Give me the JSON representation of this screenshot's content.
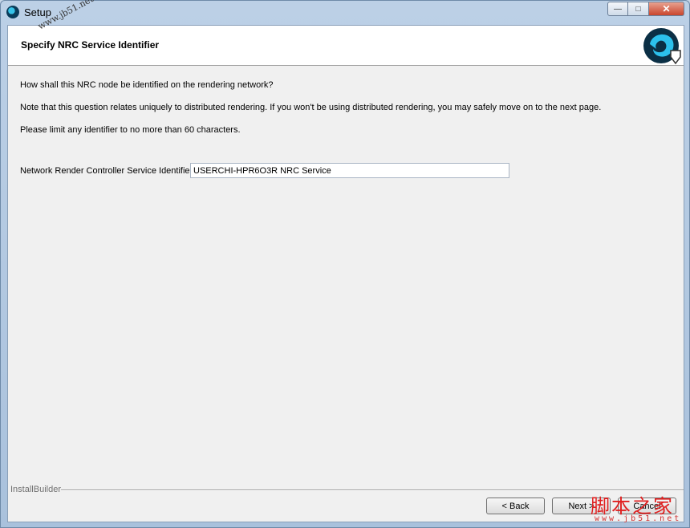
{
  "window": {
    "title": "Setup",
    "icon": "setup-app-icon"
  },
  "window_controls": {
    "minimize": "—",
    "maximize": "□",
    "close": "✕"
  },
  "header": {
    "title": "Specify NRC Service Identifier",
    "logo": "installbuilder-logo-icon"
  },
  "content": {
    "question": "How shall this NRC node be identified on the rendering network?",
    "note": "Note that this question relates uniquely to distributed rendering.  If you won't be using distributed rendering, you may safely move on to the next page.",
    "limit": "Please limit any identifier to no more than 60 characters."
  },
  "field": {
    "label": "Network Render Controller Service Identifier",
    "value": "USERCHI-HPR6O3R NRC Service"
  },
  "footer": {
    "brand": "InstallBuilder"
  },
  "buttons": {
    "back": "< Back",
    "next": "Next >",
    "cancel": "Cancel"
  },
  "watermark": {
    "diagonal": "www.jb51.net",
    "chinese": "脚本之家",
    "url": "www.jb51.net"
  },
  "colors": {
    "accent": "#37c3e8",
    "watermark_red": "#e02020"
  }
}
